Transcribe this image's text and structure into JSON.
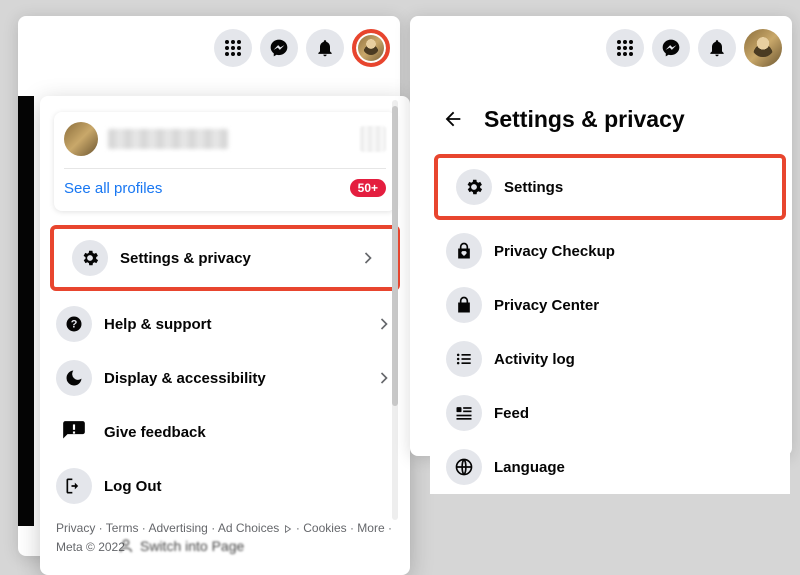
{
  "left": {
    "profile": {
      "see_all": "See all profiles",
      "badge": "50+"
    },
    "menu": {
      "settings_privacy": "Settings & privacy",
      "help_support": "Help & support",
      "display_accessibility": "Display & accessibility",
      "give_feedback": "Give feedback",
      "log_out": "Log Out"
    },
    "footer": {
      "privacy": "Privacy",
      "terms": "Terms",
      "advertising": "Advertising",
      "ad_choices": "Ad Choices",
      "cookies": "Cookies",
      "more": "More",
      "meta": "Meta © 2022"
    },
    "switch": "Switch into Page"
  },
  "right": {
    "title": "Settings & privacy",
    "menu": {
      "settings": "Settings",
      "privacy_checkup": "Privacy Checkup",
      "privacy_center": "Privacy Center",
      "activity_log": "Activity log",
      "feed": "Feed",
      "language": "Language"
    }
  }
}
